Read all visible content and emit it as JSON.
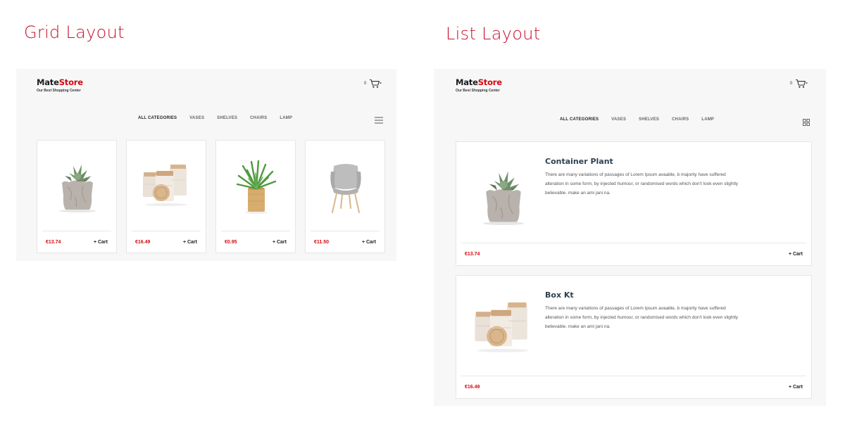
{
  "headings": {
    "grid": "Grid Layout",
    "list": "List Layout"
  },
  "brand": {
    "name_part1": "Mate",
    "name_part2": "Store",
    "tagline": "Our Best Shopping Center"
  },
  "cart": {
    "count": "0"
  },
  "nav": [
    "ALL CATEGORIES",
    "VASES",
    "SHELVES",
    "CHAIRS",
    "LAMP"
  ],
  "grid_products": [
    {
      "price": "€13.74",
      "cart_label": "+ Cart",
      "image": "succulent-bag"
    },
    {
      "price": "€16.49",
      "cart_label": "+ Cart",
      "image": "ceramic-jars"
    },
    {
      "price": "€0.95",
      "cart_label": "+ Cart",
      "image": "air-plant-wood"
    },
    {
      "price": "€11.50",
      "cart_label": "+ Cart",
      "image": "grey-chair"
    }
  ],
  "list_products": [
    {
      "title": "Container Plant",
      "desc_lines": [
        "There are many variations of passages of Lorem Ipsum avaable, b majority have suffered",
        "alteration in some form, by injected humour, or randomised words which don't look even slightly",
        "believable. make an ami jani na."
      ],
      "price": "€13.74",
      "cart_label": "+ Cart",
      "image": "succulent-bag"
    },
    {
      "title": "Box Kt",
      "desc_lines": [
        "There are many variations of passages of Lorem Ipsum avaable, b majority have suffered",
        "alteration in some form, by injected humour, or randomised words which don't look even slightly",
        "believable. make an ami jani na."
      ],
      "price": "€16.49",
      "cart_label": "+ Cart",
      "image": "ceramic-jars"
    }
  ],
  "colors": {
    "accent": "#c8102e",
    "price": "#d10a11",
    "title": "#2d4150",
    "panel": "#f7f7f7"
  }
}
